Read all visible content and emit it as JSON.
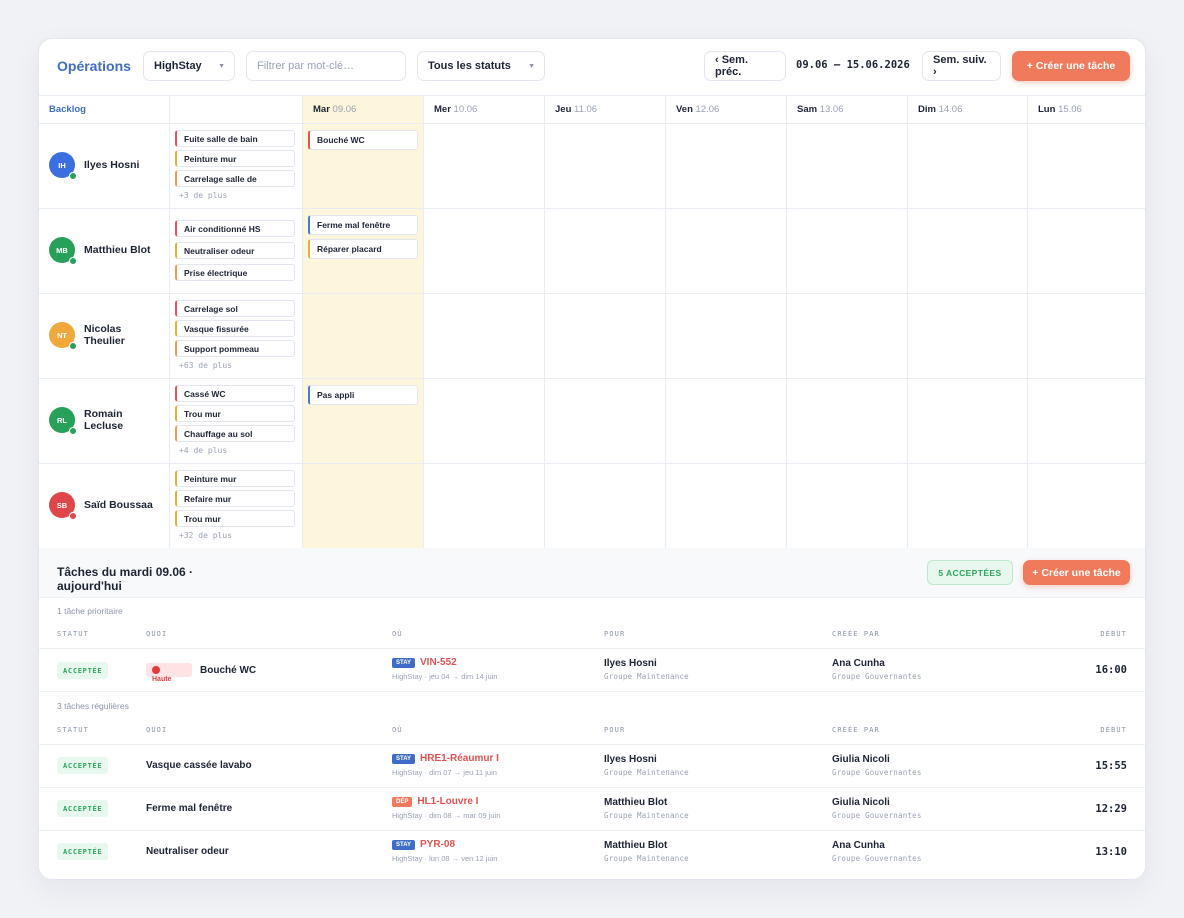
{
  "toolbar": {
    "title": "Opérations",
    "hotel_select": "HighStay",
    "filter_placeholder": "Filtrer par mot-clé…",
    "status_select": "Tous les statuts",
    "prev_week": "‹ Sem. préc.",
    "date_range": "09.06 — 15.06.2026",
    "next_week": "Sem. suiv. ›",
    "create_task": "+ Créer une tâche"
  },
  "grid": {
    "backlog_label": "Backlog",
    "days": [
      {
        "name": "Mar",
        "date": "09.06"
      },
      {
        "name": "Mer",
        "date": "10.06"
      },
      {
        "name": "Jeu",
        "date": "11.06"
      },
      {
        "name": "Ven",
        "date": "12.06"
      },
      {
        "name": "Sam",
        "date": "13.06"
      },
      {
        "name": "Dim",
        "date": "14.06"
      },
      {
        "name": "Lun",
        "date": "15.06"
      }
    ],
    "people": [
      {
        "initials": "IH",
        "name": "Ilyes Hosni",
        "backlog": [
          "Fuite salle de bain",
          "Peinture mur",
          "Carrelage salle de"
        ],
        "more": "+3 de plus",
        "today": [
          "Bouché WC"
        ]
      },
      {
        "initials": "MB",
        "name": "Matthieu Blot",
        "backlog": [
          "Air conditionné HS",
          "Neutraliser odeur",
          "Prise électrique"
        ],
        "more": "",
        "today": [
          "Ferme mal fenêtre",
          "Réparer placard"
        ]
      },
      {
        "initials": "NT",
        "name": "Nicolas Theulier",
        "backlog": [
          "Carrelage sol",
          "Vasque fissurée",
          "Support pommeau"
        ],
        "more": "+63 de plus",
        "today": []
      },
      {
        "initials": "RL",
        "name": "Romain Lecluse",
        "backlog": [
          "Cassé WC",
          "Trou mur",
          "Chauffage au sol"
        ],
        "more": "+4 de plus",
        "today": [
          "Pas appli"
        ]
      },
      {
        "initials": "SB",
        "name": "Saïd Boussaa",
        "backlog": [
          "Peinture mur",
          "Refaire mur",
          "Trou mur"
        ],
        "more": "+32 de plus",
        "today": []
      }
    ]
  },
  "tasks": {
    "title": "Tâches du mardi 09.06 · aujourd'hui",
    "accepted_badge": "5 ACCEPTÉES",
    "create_task": "+ Créer une tâche",
    "priority_section": "1 tâche prioritaire",
    "regular_section": "3 tâches régulières",
    "columns": {
      "statut": "STATUT",
      "quoi": "QUOI",
      "ou": "OÙ",
      "pour": "POUR",
      "creee_par": "CRÉÉE PAR",
      "debut": "DÉBUT"
    },
    "priority": [
      {
        "status": "ACCEPTÉE",
        "priority": "Haute",
        "quoi": "Bouché WC",
        "tag": "STAY",
        "ou": "VIN-552",
        "ou_sub": "HighStay · jeu 04 → dim 14 juin",
        "pour": "Ilyes Hosni",
        "pour_sub": "Groupe Maintenance",
        "creee_par": "Ana Cunha",
        "creee_sub": "Groupe Gouvernantes",
        "debut": "16:00"
      }
    ],
    "regular": [
      {
        "status": "ACCEPTÉE",
        "quoi": "Vasque cassée lavabo",
        "tag": "STAY",
        "ou": "HRE1-Réaumur I",
        "ou_sub": "HighStay · dim 07 → jeu 11 juin",
        "pour": "Ilyes Hosni",
        "pour_sub": "Groupe Maintenance",
        "creee_par": "Giulia Nicoli",
        "creee_sub": "Groupe Gouvernantes",
        "debut": "15:55"
      },
      {
        "status": "ACCEPTÉE",
        "quoi": "Ferme mal fenêtre",
        "tag": "DÉP",
        "ou": "HL1-Louvre I",
        "ou_sub": "HighStay · dim 08 → mar 09 juin",
        "pour": "Matthieu Blot",
        "pour_sub": "Groupe Maintenance",
        "creee_par": "Giulia Nicoli",
        "creee_sub": "Groupe Gouvernantes",
        "debut": "12:29"
      },
      {
        "status": "ACCEPTÉE",
        "quoi": "Neutraliser odeur",
        "tag": "STAY",
        "ou": "PYR-08",
        "ou_sub": "HighStay · lun 08 → ven 12 juin",
        "pour": "Matthieu Blot",
        "pour_sub": "Groupe Maintenance",
        "creee_par": "Ana Cunha",
        "creee_sub": "Groupe Gouvernantes",
        "debut": "13:10"
      }
    ]
  },
  "colors": {
    "accent": "#f07a5c",
    "title_blue": "#3f6cc6",
    "today_bg": "#fdf6dc",
    "accepted_green": "#2aa55d",
    "tag_stay": "#3f6cc6",
    "tag_dep": "#f07a5c",
    "avatar_ih": "#3b6fe0",
    "avatar_mb": "#27a05a",
    "avatar_nt": "#f0a73c",
    "avatar_rl": "#27a05a",
    "avatar_sb": "#e0454a",
    "presence_online": "#27a05a",
    "presence_busy": "#e0454a",
    "chip_red": "#e05757",
    "chip_yellow": "#e3b23c",
    "chip_orange": "#ef9a5a",
    "chip_blue": "#4a78d8"
  }
}
